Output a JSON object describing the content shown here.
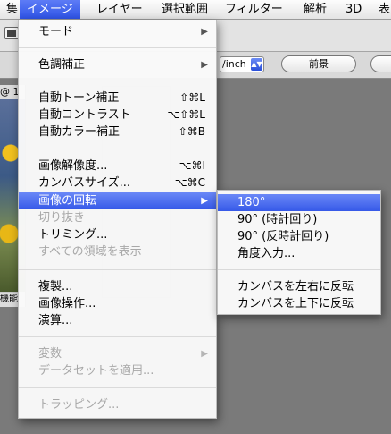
{
  "menubar": {
    "items": [
      "集",
      "イメージ",
      "レイヤー",
      "選択範囲",
      "フィルター",
      "解析",
      "3D",
      "表"
    ],
    "active_index": 1
  },
  "toolbar": {
    "unit_select": "/inch",
    "front_image_button": "前景"
  },
  "document": {
    "title": "@ 1",
    "footer": "機能"
  },
  "image_menu": {
    "items": [
      {
        "label": "モード",
        "shortcut": "",
        "submenu": true,
        "disabled": false
      },
      {
        "label": "色調補正",
        "shortcut": "",
        "submenu": true,
        "disabled": false
      },
      {
        "label": "自動トーン補正",
        "shortcut": "⇧⌘L",
        "submenu": false,
        "disabled": false
      },
      {
        "label": "自動コントラスト",
        "shortcut": "⌥⇧⌘L",
        "submenu": false,
        "disabled": false
      },
      {
        "label": "自動カラー補正",
        "shortcut": "⇧⌘B",
        "submenu": false,
        "disabled": false
      },
      {
        "label": "画像解像度...",
        "shortcut": "⌥⌘I",
        "submenu": false,
        "disabled": false
      },
      {
        "label": "カンバスサイズ...",
        "shortcut": "⌥⌘C",
        "submenu": false,
        "disabled": false
      },
      {
        "label": "画像の回転",
        "shortcut": "",
        "submenu": true,
        "disabled": false,
        "highlighted": true
      },
      {
        "label": "切り抜き",
        "shortcut": "",
        "submenu": false,
        "disabled": true
      },
      {
        "label": "トリミング...",
        "shortcut": "",
        "submenu": false,
        "disabled": false
      },
      {
        "label": "すべての領域を表示",
        "shortcut": "",
        "submenu": false,
        "disabled": true
      },
      {
        "label": "複製...",
        "shortcut": "",
        "submenu": false,
        "disabled": false
      },
      {
        "label": "画像操作...",
        "shortcut": "",
        "submenu": false,
        "disabled": false
      },
      {
        "label": "演算...",
        "shortcut": "",
        "submenu": false,
        "disabled": false
      },
      {
        "label": "変数",
        "shortcut": "",
        "submenu": true,
        "disabled": true
      },
      {
        "label": "データセットを適用...",
        "shortcut": "",
        "submenu": false,
        "disabled": true
      },
      {
        "label": "トラッピング...",
        "shortcut": "",
        "submenu": false,
        "disabled": true
      }
    ]
  },
  "rotate_submenu": {
    "items": [
      {
        "label": "180°",
        "highlighted": true
      },
      {
        "label": "90° (時計回り)"
      },
      {
        "label": "90° (反時計回り)"
      },
      {
        "label": "角度入力..."
      },
      {
        "label": "カンバスを左右に反転"
      },
      {
        "label": "カンバスを上下に反転"
      }
    ]
  },
  "colors": {
    "highlight": "#3659e8",
    "disabled_text": "#a8a8a8"
  }
}
